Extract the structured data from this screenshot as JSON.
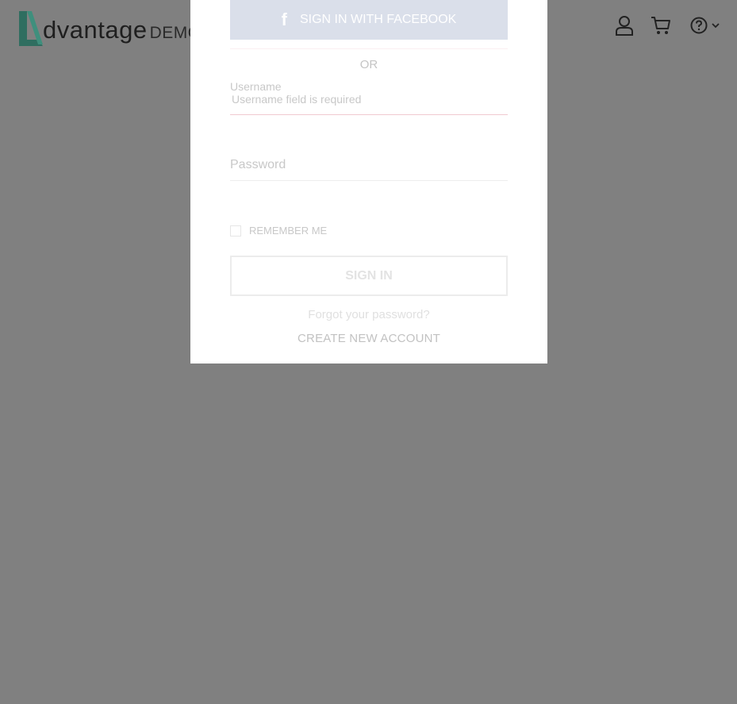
{
  "header": {
    "logo_word": "dvantage",
    "logo_suffix": "DEMO",
    "icons": [
      "user-icon",
      "cart-icon",
      "help-icon",
      "chevron-down-icon"
    ]
  },
  "login_modal": {
    "facebook_button_label": "SIGN IN WITH FACEBOOK",
    "facebook_icon": "f",
    "separator_text": "OR",
    "username": {
      "label": "Username",
      "error": "Username field is required"
    },
    "password": {
      "label": "Password"
    },
    "remember_me_label": "REMEMBER ME",
    "remember_me_checked": false,
    "sign_in_label": "SIGN IN",
    "forgot_password_link": "Forgot your password?",
    "create_account_link": "CREATE NEW ACCOUNT"
  },
  "colors": {
    "overlay": "#808080",
    "logo_accent": "#2f6e60",
    "facebook_button": "#dadfea",
    "error_underline": "#f0c9d0"
  }
}
